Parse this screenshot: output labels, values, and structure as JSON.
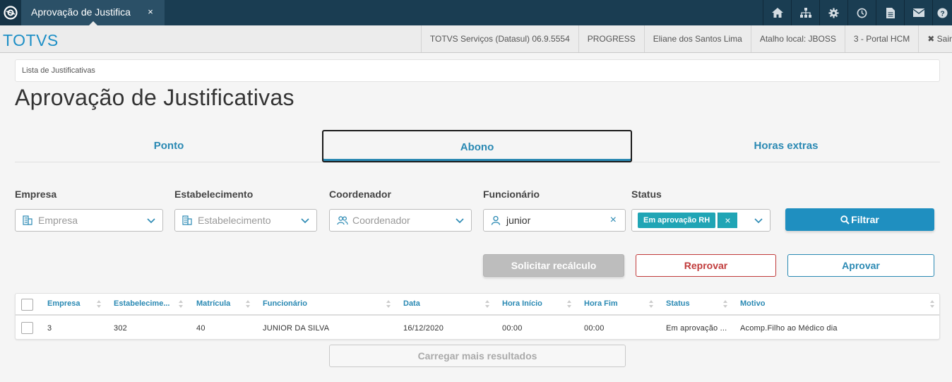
{
  "topbar": {
    "tab_title": "Aprovação de Justifica",
    "tab_close": "×",
    "icons": [
      "home-icon",
      "sitemap-icon",
      "gear-icon",
      "clock-icon",
      "document-icon",
      "mail-icon",
      "help-icon"
    ]
  },
  "header": {
    "brand": "TOTVS",
    "info": [
      "TOTVS Serviços (Datasul) 06.9.5554",
      "PROGRESS",
      "Eliane dos Santos Lima",
      "Atalho local: JBOSS",
      "3 - Portal HCM"
    ],
    "logout": "✖ Sair"
  },
  "breadcrumb": "Lista de Justificativas",
  "page_title": "Aprovação de Justificativas",
  "tabs": [
    {
      "label": "Ponto",
      "active": false
    },
    {
      "label": "Abono",
      "active": true
    },
    {
      "label": "Horas extras",
      "active": false
    }
  ],
  "filters": {
    "empresa": {
      "label": "Empresa",
      "placeholder": "Empresa"
    },
    "estabelecimento": {
      "label": "Estabelecimento",
      "placeholder": "Estabelecimento"
    },
    "coordenador": {
      "label": "Coordenador",
      "placeholder": "Coordenador"
    },
    "funcionario": {
      "label": "Funcionário",
      "value": "junior",
      "clear": "×"
    },
    "status": {
      "label": "Status",
      "chip": "Em aprovação RH",
      "chip_close": "×"
    },
    "filter_button": "Filtrar"
  },
  "actions": {
    "recalc": "Solicitar recálculo",
    "reprovar": "Reprovar",
    "aprovar": "Aprovar"
  },
  "table": {
    "columns": [
      "Empresa",
      "Estabelecime...",
      "Matrícula",
      "Funcionário",
      "Data",
      "Hora Início",
      "Hora Fim",
      "Status",
      "Motivo"
    ],
    "rows": [
      [
        "3",
        "302",
        "40",
        "JUNIOR DA SILVA",
        "16/12/2020",
        "00:00",
        "00:00",
        "Em aprovação ...",
        "Acomp.Filho ao Médico dia"
      ]
    ]
  },
  "load_more": "Carregar mais resultados",
  "colors": {
    "topbar": "#1a3d52",
    "accent": "#2a89b3",
    "brand": "#1d8fc6",
    "chip": "#20a5b5",
    "danger": "#c03a3a",
    "disabled": "#bdbdbd"
  }
}
